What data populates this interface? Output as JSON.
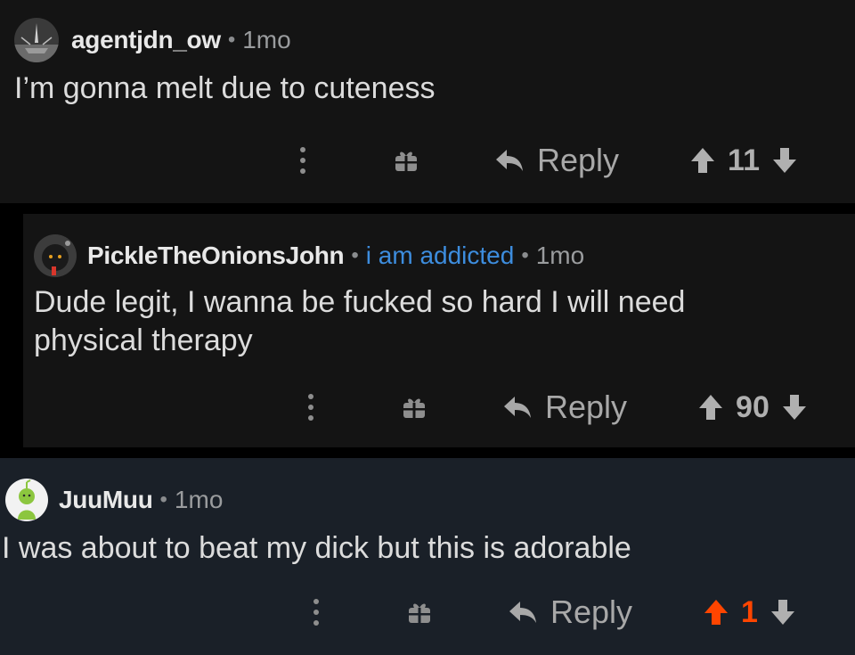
{
  "comments": [
    {
      "username": "agentjdn_ow",
      "separator": "•",
      "time": "1mo",
      "body": "I’m gonna melt due to cuteness",
      "reply_label": "Reply",
      "score": "11",
      "upvoted": false
    },
    {
      "username": "PickleTheOnionsJohn",
      "separator": "•",
      "flair": "i am addicted",
      "time": "1mo",
      "body": "Dude legit, I wanna be fucked so hard I will need physical therapy",
      "reply_label": "Reply",
      "score": "90",
      "upvoted": false
    },
    {
      "username": "JuuMuu",
      "separator": "•",
      "time": "1mo",
      "body": "I was about to beat my dick but this is adorable",
      "reply_label": "Reply",
      "score": "1",
      "upvoted": true
    }
  ],
  "colors": {
    "background": "#000000",
    "card": "#141414",
    "highlighted_card": "#1a2028",
    "flair": "#3d8dde",
    "upvote_active": "#ff4500",
    "icon": "#8e8e8e"
  },
  "icons": [
    "more-vertical-icon",
    "gift-icon",
    "reply-arrow-icon",
    "upvote-arrow-icon",
    "downvote-arrow-icon"
  ]
}
